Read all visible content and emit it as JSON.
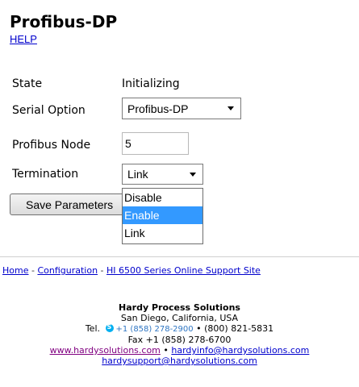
{
  "page": {
    "title": "Profibus-DP",
    "help": "HELP"
  },
  "form": {
    "state_label": "State",
    "state_value": "Initializing",
    "serial_label": "Serial Option",
    "serial_value": "Profibus-DP",
    "node_label": "Profibus Node",
    "node_value": "5",
    "termination_label": "Termination",
    "termination_value": "Link",
    "termination_options": [
      "Disable",
      "Enable",
      "Link"
    ],
    "termination_highlighted": "Enable",
    "save_button": "Save Parameters"
  },
  "footer": {
    "home": "Home",
    "sep1": " - ",
    "configuration": "Configuration",
    "sep2": " - ",
    "support": "HI 6500 Series Online Support Site",
    "company": "Hardy Process Solutions",
    "city": "San Diego, California, USA",
    "tel_label": "Tel.",
    "skype_number": "+1 (858) 278-2900",
    "tel_number": " • (800) 821-5831",
    "fax": "Fax +1 (858) 278-6700",
    "website": "www.hardysolutions.com",
    "bullet": " • ",
    "info_email": "hardyinfo@hardysolutions.com",
    "support_email": "hardysupport@hardysolutions.com"
  }
}
